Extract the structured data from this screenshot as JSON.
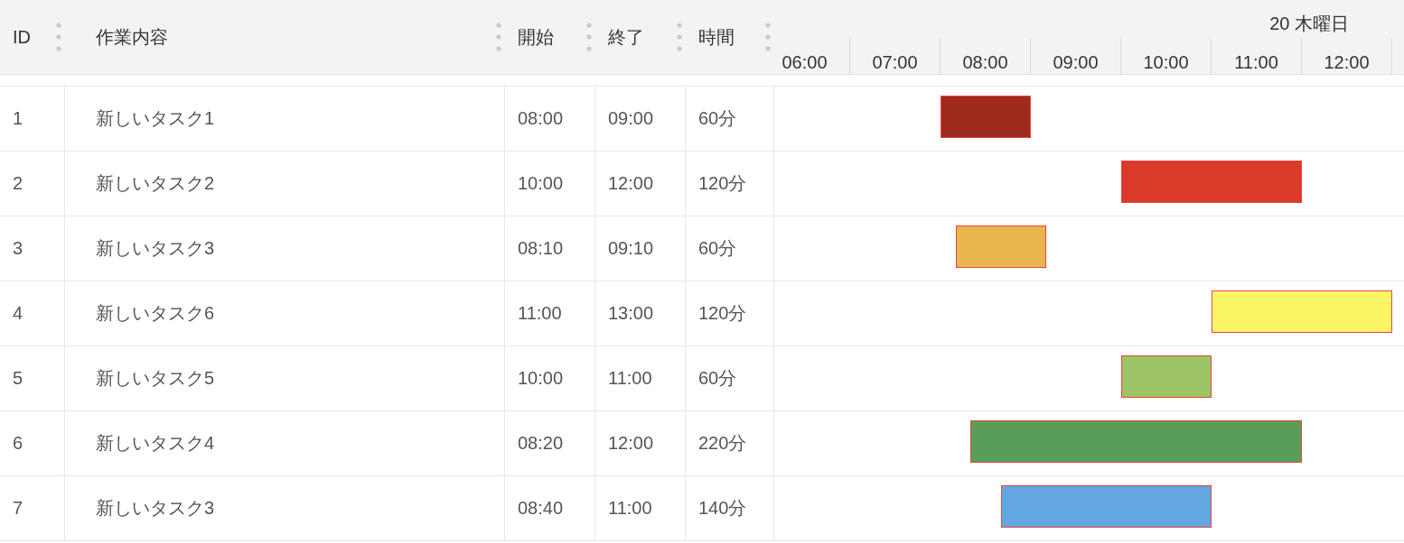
{
  "columns": [
    "ID",
    "作業内容",
    "開始",
    "終了",
    "時間"
  ],
  "timeline": {
    "date": "20 木曜日",
    "hours": [
      "06:00",
      "07:00",
      "08:00",
      "09:00",
      "10:00",
      "11:00",
      "12:00"
    ]
  },
  "rows": [
    {
      "id": "1",
      "name": "新しいタスク1",
      "start": "08:00",
      "end": "09:00",
      "duration": "60分",
      "color": "#9e2a1e"
    },
    {
      "id": "2",
      "name": "新しいタスク2",
      "start": "10:00",
      "end": "12:00",
      "duration": "120分",
      "color": "#d93a29"
    },
    {
      "id": "3",
      "name": "新しいタスク3",
      "start": "08:10",
      "end": "09:10",
      "duration": "60分",
      "color": "#e8b64e"
    },
    {
      "id": "4",
      "name": "新しいタスク6",
      "start": "11:00",
      "end": "13:00",
      "duration": "120分",
      "color": "#fbf665"
    },
    {
      "id": "5",
      "name": "新しいタスク5",
      "start": "10:00",
      "end": "11:00",
      "duration": "60分",
      "color": "#9cc464"
    },
    {
      "id": "6",
      "name": "新しいタスク4",
      "start": "08:20",
      "end": "12:00",
      "duration": "220分",
      "color": "#589e58"
    },
    {
      "id": "7",
      "name": "新しいタスク3",
      "start": "08:40",
      "end": "11:00",
      "duration": "140分",
      "color": "#62a6e2"
    }
  ]
}
